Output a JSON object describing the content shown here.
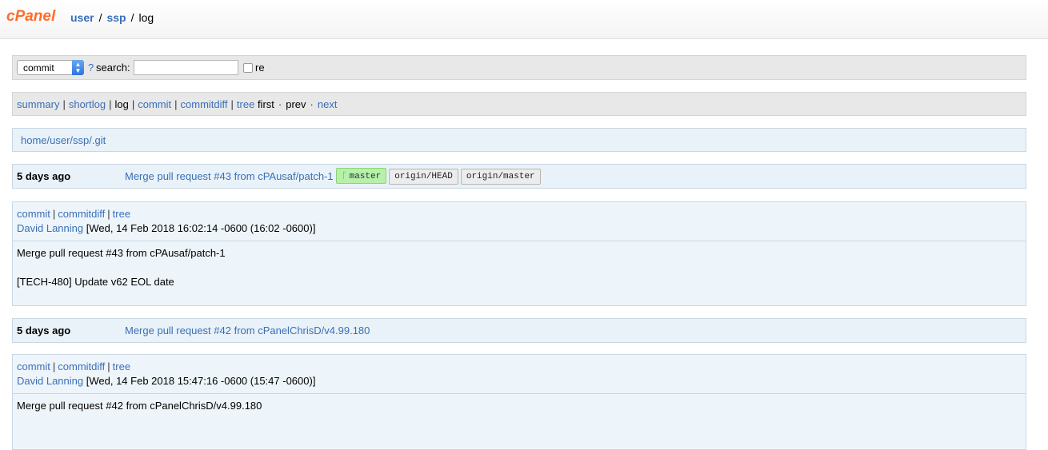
{
  "header": {
    "logo": "cPanel",
    "breadcrumb": [
      "user",
      "ssp",
      "log"
    ]
  },
  "search": {
    "select_value": "commit",
    "help": "?",
    "label": "search:",
    "value": "",
    "re_label": "re"
  },
  "nav": {
    "summary": "summary",
    "shortlog": "shortlog",
    "log": "log",
    "commit": "commit",
    "commitdiff": "commitdiff",
    "tree": "tree",
    "first": "first",
    "prev": "prev",
    "next": "next"
  },
  "path": "home/user/ssp/.git",
  "commits": [
    {
      "age": "5 days ago",
      "subject": "Merge pull request #43 from cPAusaf/patch-1",
      "refs": [
        "master",
        "origin/HEAD",
        "origin/master"
      ],
      "links": [
        "commit",
        "commitdiff",
        "tree"
      ],
      "author": "David Lanning",
      "date": "[Wed, 14 Feb 2018 16:02:14 -0600 (16:02 -0600)]",
      "message": [
        "Merge pull request #43 from cPAusaf/patch-1",
        "[TECH-480] Update v62 EOL date"
      ]
    },
    {
      "age": "5 days ago",
      "subject": "Merge pull request #42 from cPanelChrisD/v4.99.180",
      "refs": [],
      "links": [
        "commit",
        "commitdiff",
        "tree"
      ],
      "author": "David Lanning",
      "date": "[Wed, 14 Feb 2018 15:47:16 -0600 (15:47 -0600)]",
      "message": [
        "Merge pull request #42 from cPanelChrisD/v4.99.180"
      ]
    }
  ],
  "colors": {
    "link": "#3a6fb8",
    "logo": "#ff6c2c",
    "head_ref": "#b7f0a8"
  }
}
